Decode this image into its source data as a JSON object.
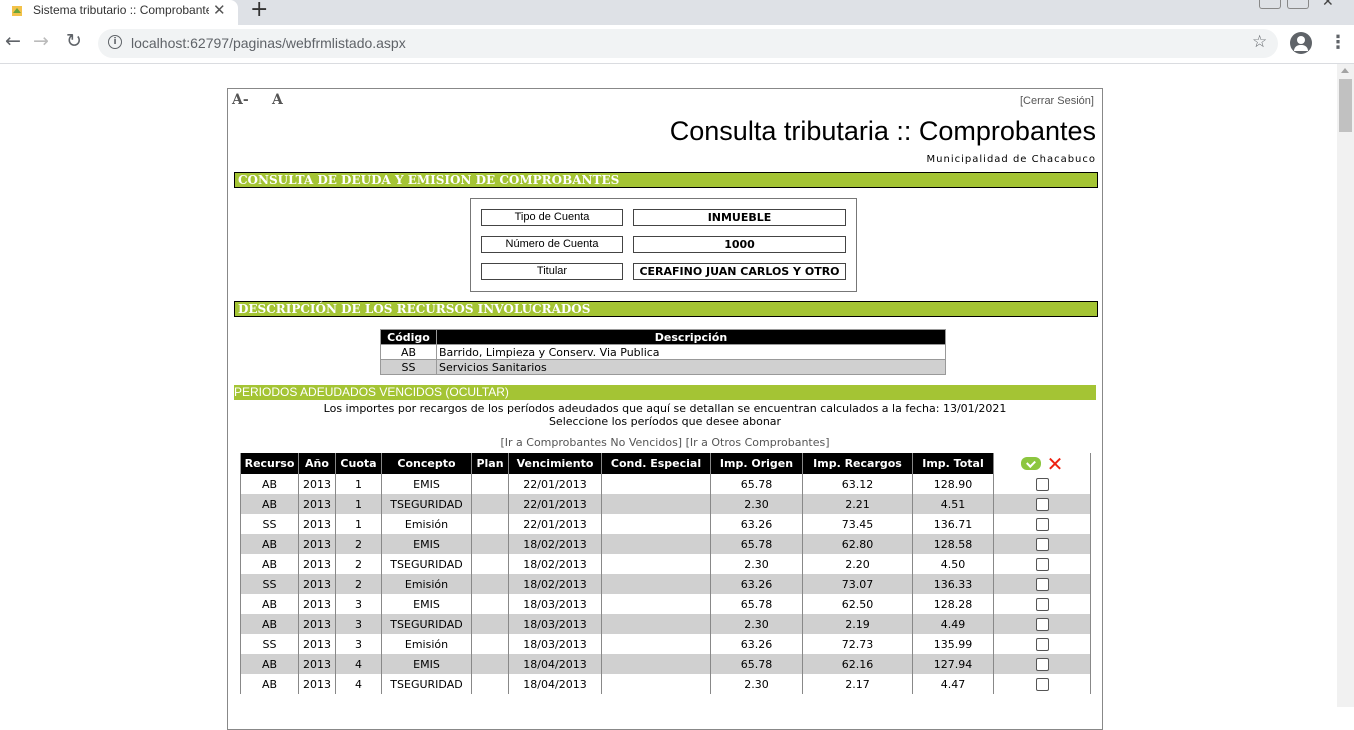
{
  "browser": {
    "tab_title": "Sistema tributario :: Comprobantes",
    "tab_close": "✕",
    "new_tab": "+",
    "url": "localhost:62797/paginas/webfrmlistado.aspx"
  },
  "header": {
    "font_smaller": "A-",
    "font_larger": "A",
    "logout": "[Cerrar Sesión]",
    "title": "Consulta tributaria :: Comprobantes",
    "municipality": "Municipalidad de Chacabuco"
  },
  "sections": {
    "debt": "CONSULTA DE DEUDA Y EMISION DE COMPROBANTES",
    "resources": "DESCRIPCIÓN DE LOS RECURSOS INVOLUCRADOS",
    "periods": "PERIODOS ADEUDADOS VENCIDOS (OCULTAR)"
  },
  "account": {
    "type_label": "Tipo de Cuenta",
    "type_value": "INMUEBLE",
    "number_label": "Número de Cuenta",
    "number_value": "1000",
    "holder_label": "Titular",
    "holder_value": "CERAFINO JUAN CARLOS Y OTRO"
  },
  "resources": {
    "headers": [
      "Código",
      "Descripción"
    ],
    "rows": [
      {
        "code": "AB",
        "desc": "Barrido, Limpieza y Conserv. Via Publica"
      },
      {
        "code": "SS",
        "desc": "Servicios Sanitarios"
      }
    ]
  },
  "notes": {
    "line1": "Los importes por recargos de los períodos adeudados que aquí se detallan se encuentran calculados a la fecha: 13/01/2021",
    "line2": "Seleccione los períodos que desee abonar",
    "link_not_due": "[Ir a Comprobantes No Vencidos]",
    "link_other": "[Ir a Otros Comprobantes]"
  },
  "periods": {
    "headers": [
      "Recurso",
      "Año",
      "Cuota",
      "Concepto",
      "Plan",
      "Vencimiento",
      "Cond. Especial",
      "Imp. Origen",
      "Imp. Recargos",
      "Imp. Total"
    ],
    "rows": [
      [
        "AB",
        "2013",
        "1",
        "EMIS",
        "",
        "22/01/2013",
        "",
        "65.78",
        "63.12",
        "128.90"
      ],
      [
        "AB",
        "2013",
        "1",
        "TSEGURIDAD",
        "",
        "22/01/2013",
        "",
        "2.30",
        "2.21",
        "4.51"
      ],
      [
        "SS",
        "2013",
        "1",
        "Emisión",
        "",
        "22/01/2013",
        "",
        "63.26",
        "73.45",
        "136.71"
      ],
      [
        "AB",
        "2013",
        "2",
        "EMIS",
        "",
        "18/02/2013",
        "",
        "65.78",
        "62.80",
        "128.58"
      ],
      [
        "AB",
        "2013",
        "2",
        "TSEGURIDAD",
        "",
        "18/02/2013",
        "",
        "2.30",
        "2.20",
        "4.50"
      ],
      [
        "SS",
        "2013",
        "2",
        "Emisión",
        "",
        "18/02/2013",
        "",
        "63.26",
        "73.07",
        "136.33"
      ],
      [
        "AB",
        "2013",
        "3",
        "EMIS",
        "",
        "18/03/2013",
        "",
        "65.78",
        "62.50",
        "128.28"
      ],
      [
        "AB",
        "2013",
        "3",
        "TSEGURIDAD",
        "",
        "18/03/2013",
        "",
        "2.30",
        "2.19",
        "4.49"
      ],
      [
        "SS",
        "2013",
        "3",
        "Emisión",
        "",
        "18/03/2013",
        "",
        "63.26",
        "72.73",
        "135.99"
      ],
      [
        "AB",
        "2013",
        "4",
        "EMIS",
        "",
        "18/04/2013",
        "",
        "65.78",
        "62.16",
        "127.94"
      ],
      [
        "AB",
        "2013",
        "4",
        "TSEGURIDAD",
        "",
        "18/04/2013",
        "",
        "2.30",
        "2.17",
        "4.47"
      ]
    ]
  },
  "icons": {
    "select_all": "check-circle-icon",
    "clear_all": "red-x-icon"
  },
  "colors": {
    "section_green": "#a4c434",
    "row_alt": "#d0d0d0"
  }
}
